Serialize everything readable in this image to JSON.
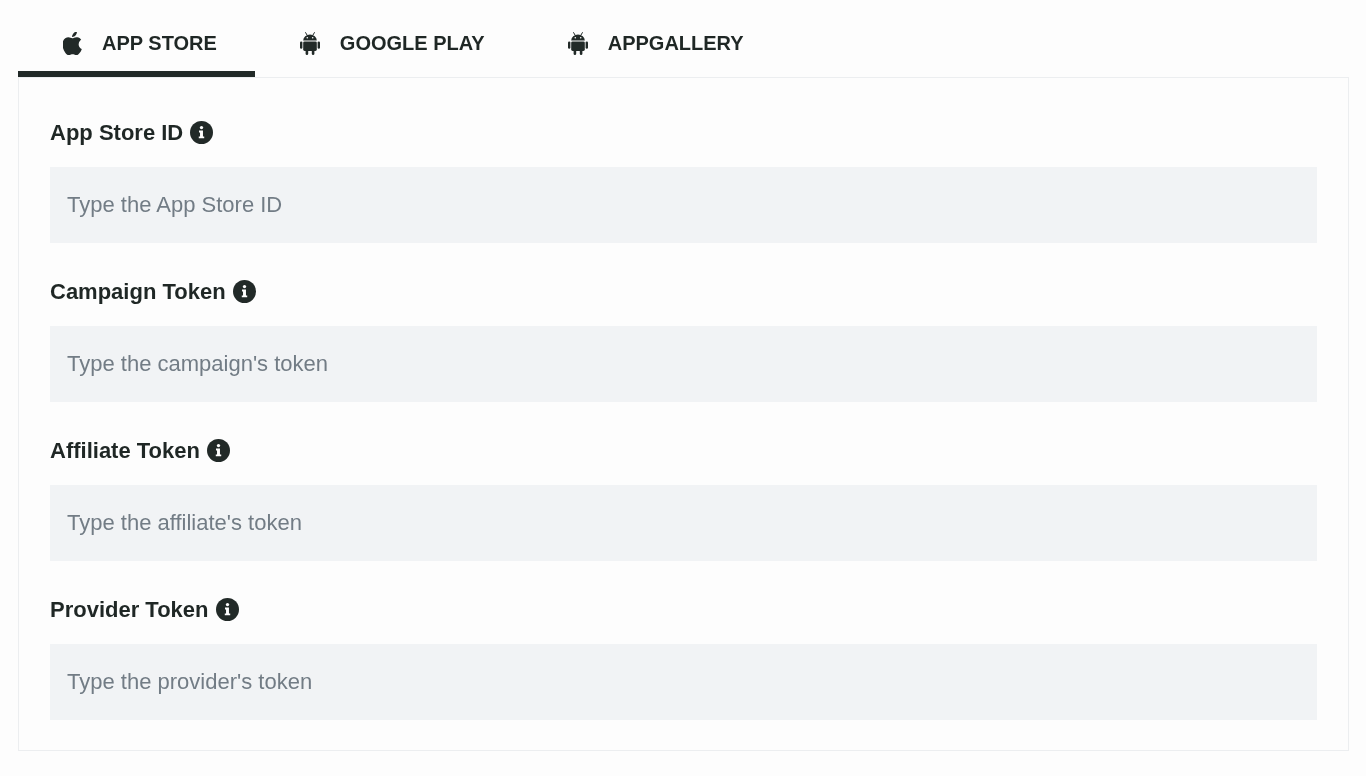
{
  "tabs": [
    {
      "label": "APP STORE",
      "kind": "apple",
      "selected": true
    },
    {
      "label": "GOOGLE PLAY",
      "kind": "android",
      "selected": false
    },
    {
      "label": "APPGALLERY",
      "kind": "android",
      "selected": false
    }
  ],
  "fields": [
    {
      "label": "App Store ID",
      "placeholder": "Type the App Store ID"
    },
    {
      "label": "Campaign Token",
      "placeholder": "Type the campaign's token"
    },
    {
      "label": "Affiliate Token",
      "placeholder": "Type the affiliate's token"
    },
    {
      "label": "Provider Token",
      "placeholder": "Type the provider's token"
    }
  ]
}
